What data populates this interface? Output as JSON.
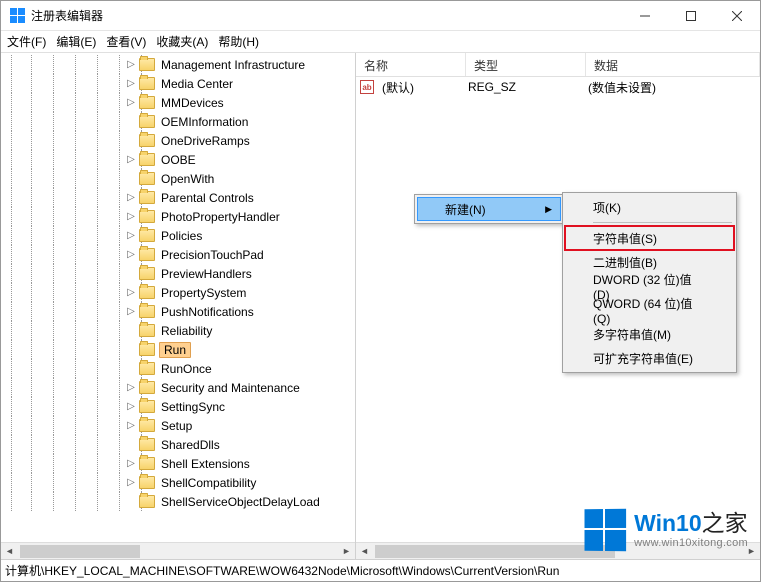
{
  "window": {
    "title": "注册表编辑器"
  },
  "menu": {
    "file": "文件(F)",
    "edit": "编辑(E)",
    "view": "查看(V)",
    "favorites": "收藏夹(A)",
    "help": "帮助(H)"
  },
  "tree": {
    "items": [
      {
        "label": "Management Infrastructure",
        "expandable": true
      },
      {
        "label": "Media Center",
        "expandable": true
      },
      {
        "label": "MMDevices",
        "expandable": true
      },
      {
        "label": "OEMInformation",
        "expandable": false
      },
      {
        "label": "OneDriveRamps",
        "expandable": false
      },
      {
        "label": "OOBE",
        "expandable": true
      },
      {
        "label": "OpenWith",
        "expandable": false
      },
      {
        "label": "Parental Controls",
        "expandable": true
      },
      {
        "label": "PhotoPropertyHandler",
        "expandable": true
      },
      {
        "label": "Policies",
        "expandable": true
      },
      {
        "label": "PrecisionTouchPad",
        "expandable": true
      },
      {
        "label": "PreviewHandlers",
        "expandable": false
      },
      {
        "label": "PropertySystem",
        "expandable": true
      },
      {
        "label": "PushNotifications",
        "expandable": true
      },
      {
        "label": "Reliability",
        "expandable": false
      },
      {
        "label": "Run",
        "expandable": false,
        "selected": true
      },
      {
        "label": "RunOnce",
        "expandable": false
      },
      {
        "label": "Security and Maintenance",
        "expandable": true
      },
      {
        "label": "SettingSync",
        "expandable": true
      },
      {
        "label": "Setup",
        "expandable": true
      },
      {
        "label": "SharedDlls",
        "expandable": false
      },
      {
        "label": "Shell Extensions",
        "expandable": true
      },
      {
        "label": "ShellCompatibility",
        "expandable": true
      },
      {
        "label": "ShellServiceObjectDelayLoad",
        "expandable": false
      }
    ]
  },
  "list": {
    "headers": {
      "name": "名称",
      "type": "类型",
      "data": "数据"
    },
    "rows": [
      {
        "name": "(默认)",
        "type": "REG_SZ",
        "data": "(数值未设置)"
      }
    ]
  },
  "context_menu": {
    "new": "新建(N)",
    "submenu": [
      {
        "label": "项(K)",
        "sep_after": true
      },
      {
        "label": "字符串值(S)",
        "highlight": true
      },
      {
        "label": "二进制值(B)"
      },
      {
        "label": "DWORD (32 位)值(D)"
      },
      {
        "label": "QWORD (64 位)值(Q)"
      },
      {
        "label": "多字符串值(M)"
      },
      {
        "label": "可扩充字符串值(E)"
      }
    ]
  },
  "statusbar": {
    "path": "计算机\\HKEY_LOCAL_MACHINE\\SOFTWARE\\WOW6432Node\\Microsoft\\Windows\\CurrentVersion\\Run"
  },
  "watermark": {
    "brand_a": "Win10",
    "brand_b": "之家",
    "url": "www.win10xitong.com"
  }
}
